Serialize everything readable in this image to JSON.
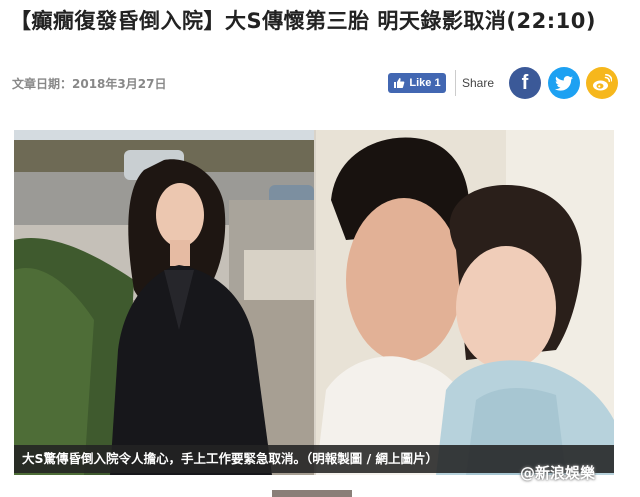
{
  "article": {
    "headline": "【癲癇復發昏倒入院】大S傳懷第三胎 明天錄影取消(22:10)",
    "date_label": "文章日期：2018年3月27日"
  },
  "social": {
    "like_label": "Like 1",
    "share_label": "Share",
    "icons": [
      "facebook-icon",
      "twitter-icon",
      "weibo-icon"
    ],
    "colors": {
      "facebook": "#3b5998",
      "twitter": "#1da1f2",
      "weibo": "#f6b71c",
      "like": "#4267b2"
    }
  },
  "photo": {
    "caption": "大S驚傳昏倒入院令人擔心，手上工作要緊急取消。（明報製圖 / 網上圖片）",
    "watermark": "@新浪娛樂"
  }
}
